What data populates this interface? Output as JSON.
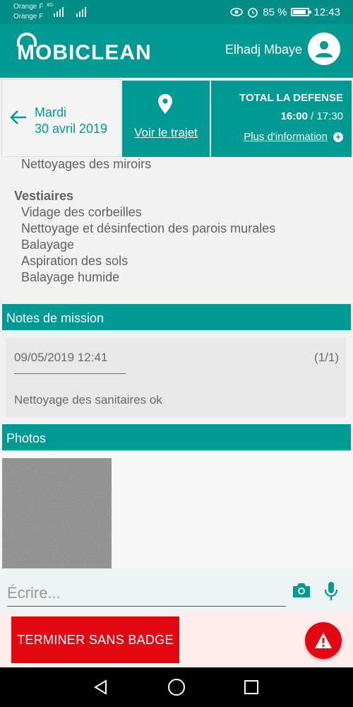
{
  "status_bar": {
    "carrier_1": "Orange F",
    "carrier_2": "Orange F",
    "network": "4G",
    "battery": "85 %",
    "time": "12:43"
  },
  "app": {
    "logo": "MOBICLEAN",
    "user_name": "Elhadj Mbaye"
  },
  "mission": {
    "day": "Mardi",
    "date": "30 avril 2019",
    "route_label": "Voir le trajet",
    "site_name": "TOTAL LA DEFENSE",
    "start_time": "16:00",
    "time_separator": " / ",
    "end_time": "17:30",
    "more_info_label": "Plus d'information"
  },
  "tasks": {
    "previous_item": "Nettoyages des miroirs",
    "group_title": "Vestiaires",
    "items": [
      "Vidage des corbeilles",
      "Nettoyage et désinfection des parois murales",
      "Balayage",
      "Aspiration des sols",
      "Balayage humide"
    ]
  },
  "notes": {
    "header": "Notes de mission",
    "entry": {
      "datetime": "09/05/2019 12:41",
      "counter": "(1/1)",
      "text": "Nettoyage des sanitaires ok"
    }
  },
  "photos": {
    "header": "Photos"
  },
  "compose": {
    "placeholder": "Écrire..."
  },
  "footer": {
    "finish_label": "TERMINER SANS BADGE"
  },
  "colors": {
    "primary": "#009a93",
    "danger": "#e30613"
  }
}
